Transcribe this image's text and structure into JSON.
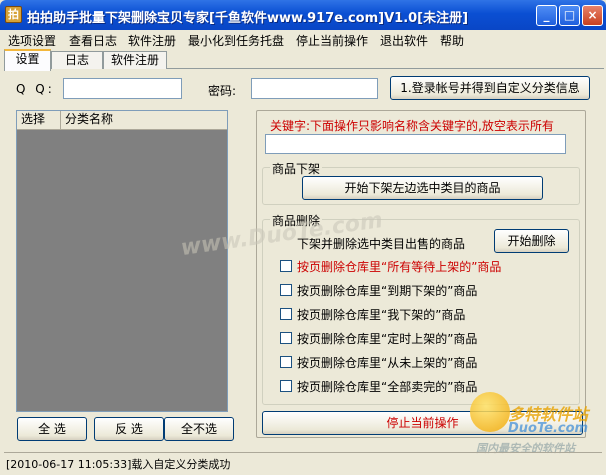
{
  "window": {
    "title": "拍拍助手批量下架删除宝贝专家[千鱼软件www.917e.com]V1.0[未注册]",
    "icon_label": "拍",
    "minimize": "_",
    "maximize": "□",
    "close": "×"
  },
  "menu": [
    "选项设置",
    "查看日志",
    "软件注册",
    "最小化到任务托盘",
    "停止当前操作",
    "退出软件",
    "帮助"
  ],
  "tabs": [
    "设置",
    "日志",
    "软件注册"
  ],
  "login": {
    "qq_label": "Q Q:",
    "qq_value": "",
    "password_label": "密码:",
    "password_value": "",
    "login_button": "1.登录帐号并得到自定义分类信息"
  },
  "category_list": {
    "columns": [
      "选择",
      "分类名称"
    ],
    "rows": []
  },
  "list_buttons": {
    "select_all": "全 选",
    "invert": "反 选",
    "select_none": "全不选"
  },
  "keyword": {
    "label": "关键字:下面操作只影响名称含关键字的,放空表示所有",
    "value": ""
  },
  "offshelf": {
    "group_title": "商品下架",
    "start_button": "开始下架左边选中类目的商品"
  },
  "delete": {
    "group_title": "商品删除",
    "offshelf_delete_label": "下架并删除选中类目出售的商品",
    "start_button": "开始删除",
    "options": [
      {
        "label": "按页删除仓库里“所有等待上架的”商品",
        "checked": false,
        "highlight": true
      },
      {
        "label": "按页删除仓库里“到期下架的”商品",
        "checked": false,
        "highlight": false
      },
      {
        "label": "按页删除仓库里“我下架的”商品",
        "checked": false,
        "highlight": false
      },
      {
        "label": "按页删除仓库里“定时上架的”商品",
        "checked": false,
        "highlight": false
      },
      {
        "label": "按页删除仓库里“从未上架的”商品",
        "checked": false,
        "highlight": false
      },
      {
        "label": "按页删除仓库里“全部卖完的”商品",
        "checked": false,
        "highlight": false
      }
    ]
  },
  "stop_button": "停止当前操作",
  "status": "[2010-06-17 11:05:33]载入自定义分类成功",
  "watermarks": {
    "center": "www.DuoTe.com",
    "corner_brand": "多特软件站",
    "corner_site": "DuoTe.com",
    "corner_tagline": "国内最安全的软件站"
  },
  "colors": {
    "titlebar": "#0a4fd3",
    "accent_red": "#cc0000",
    "list_bg": "#808080"
  }
}
